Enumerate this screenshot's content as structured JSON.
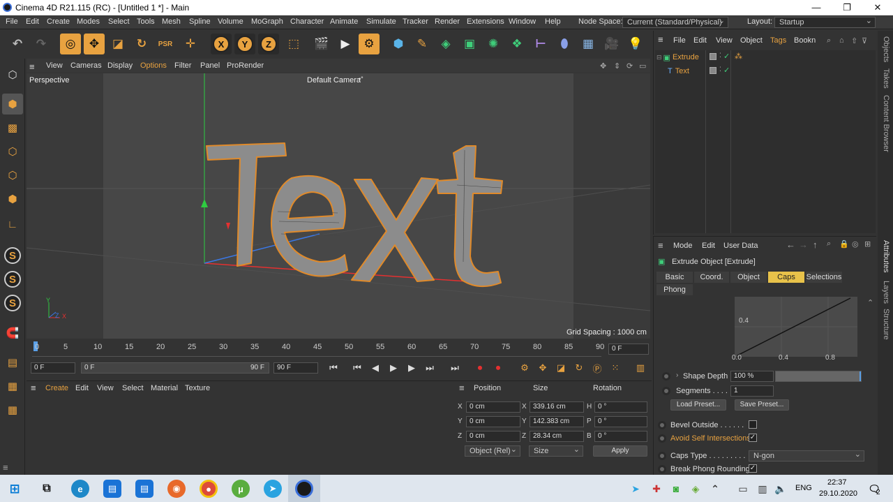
{
  "window": {
    "title": "Cinema 4D R21.115 (RC) - [Untitled 1 *] - Main",
    "minimize": "—",
    "maximize": "❐",
    "close": "✕"
  },
  "menubar": {
    "items": [
      "File",
      "Edit",
      "Create",
      "Modes",
      "Select",
      "Tools",
      "Mesh",
      "Spline",
      "Volume",
      "MoGraph",
      "Character",
      "Animate",
      "Simulate",
      "Tracker",
      "Render",
      "Extensions",
      "Window",
      "Help"
    ],
    "node_space_label": "Node Space:",
    "node_space_value": "Current (Standard/Physical)",
    "layout_label": "Layout:",
    "layout_value": "Startup"
  },
  "viewport": {
    "menu": [
      "View",
      "Cameras",
      "Display",
      "Options",
      "Filter",
      "Panel",
      "ProRender"
    ],
    "view_name": "Perspective",
    "camera": "Default Camera",
    "camera_suffix": "•°",
    "grid_spacing": "Grid Spacing : 1000 cm",
    "text_object": "Text",
    "axis_labels": {
      "y": "Y",
      "z": "Z",
      "x": "X"
    }
  },
  "timeline": {
    "ticks": [
      "0",
      "5",
      "10",
      "15",
      "20",
      "25",
      "30",
      "35",
      "40",
      "45",
      "50",
      "55",
      "60",
      "65",
      "70",
      "75",
      "80",
      "85",
      "90"
    ],
    "current_frame": "0 F",
    "start_frame": "0 F",
    "range_start": "0 F",
    "range_end": "90 F",
    "end_frame": "90 F"
  },
  "material_manager": {
    "menu": [
      "Create",
      "Edit",
      "View",
      "Select",
      "Material",
      "Texture"
    ]
  },
  "coordinates": {
    "headers": [
      "Position",
      "Size",
      "Rotation"
    ],
    "rows": [
      {
        "axis": "X",
        "pos": "0 cm",
        "size_axis": "X",
        "size": "339.16 cm",
        "rot_axis": "H",
        "rot": "0 °"
      },
      {
        "axis": "Y",
        "pos": "0 cm",
        "size_axis": "Y",
        "size": "142.383 cm",
        "rot_axis": "P",
        "rot": "0 °"
      },
      {
        "axis": "Z",
        "pos": "0 cm",
        "size_axis": "Z",
        "size": "28.34 cm",
        "rot_axis": "B",
        "rot": "0 °"
      }
    ],
    "mode_select": "Object (Rel)",
    "size_select": "Size",
    "apply": "Apply"
  },
  "object_manager": {
    "menu": [
      "File",
      "Edit",
      "View",
      "Object",
      "Tags",
      "Bookn"
    ],
    "objects": [
      {
        "name": "Extrude",
        "indent": 0
      },
      {
        "name": "Text",
        "indent": 1
      }
    ]
  },
  "attributes": {
    "menu": [
      "Mode",
      "Edit",
      "User Data"
    ],
    "object_title": "Extrude Object [Extrude]",
    "tabs": [
      "Basic",
      "Coord.",
      "Object",
      "Caps",
      "Selections",
      "Phong"
    ],
    "active_tab": "Caps",
    "graph": {
      "y_tick": "0.4",
      "x_ticks": [
        "0.0",
        "0.4",
        "0.8"
      ]
    },
    "shape_depth_label": "Shape Depth",
    "shape_depth_value": "100 %",
    "segments_label": "Segments . . . .",
    "segments_value": "1",
    "load_preset": "Load Preset...",
    "save_preset": "Save Preset...",
    "bevel_outside": "Bevel Outside . . . . . .",
    "avoid_self": "Avoid Self Intersections",
    "caps_type_label": "Caps Type . . . . . . . . .",
    "caps_type_value": "N-gon",
    "break_phong": "Break Phong Rounding"
  },
  "right_strip": {
    "top": [
      "Objects",
      "Takes",
      "Content Browser"
    ],
    "bottom": [
      "Attributes",
      "Layers",
      "Structure"
    ]
  },
  "taskbar": {
    "lang": "ENG",
    "time": "22:37",
    "date": "29.10.2020",
    "notif": "2"
  },
  "colors": {
    "accent": "#e8a240",
    "caps_tab": "#e8c24a",
    "green_text": "#e8a240"
  }
}
